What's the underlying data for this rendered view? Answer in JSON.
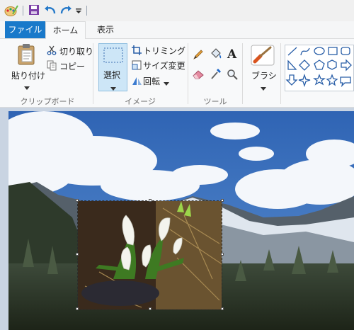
{
  "tabs": {
    "file": "ファイル",
    "home": "ホーム",
    "view": "表示"
  },
  "clipboard": {
    "paste": "貼り付け",
    "cut": "切り取り",
    "copy": "コピー",
    "label": "クリップボード"
  },
  "image": {
    "select": "選択",
    "crop": "トリミング",
    "resize": "サイズ変更",
    "rotate": "回転",
    "label": "イメージ"
  },
  "tools": {
    "label": "ツール"
  },
  "brushes": {
    "label": "ブラシ"
  },
  "colors": {
    "accent": "#1979ca",
    "selection_fill": "#cde6f7",
    "sky": "#3a6fb8",
    "canvas_bg": "#c9d4e2"
  }
}
